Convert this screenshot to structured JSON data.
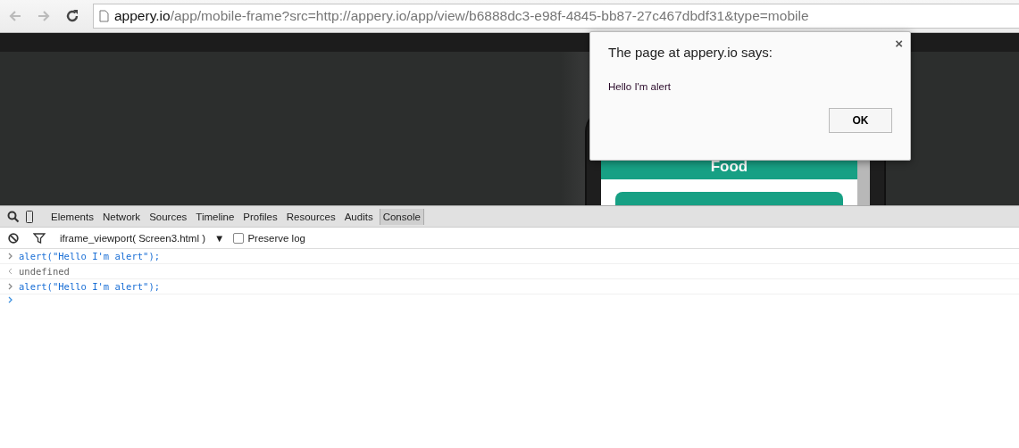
{
  "browser": {
    "url_host": "appery.io",
    "url_path": "/app/mobile-frame?src=http://appery.io/app/view/b6888dc3-e98f-4845-bb87-27c467dbdf31&type=mobile"
  },
  "app_preview": {
    "header": "Food"
  },
  "dialog": {
    "title": "The page at appery.io says:",
    "message": "Hello I'm alert",
    "ok": "OK",
    "close": "×"
  },
  "devtools": {
    "tabs": [
      {
        "label": "Elements",
        "selected": false
      },
      {
        "label": "Network",
        "selected": false
      },
      {
        "label": "Sources",
        "selected": false
      },
      {
        "label": "Timeline",
        "selected": false
      },
      {
        "label": "Profiles",
        "selected": false
      },
      {
        "label": "Resources",
        "selected": false
      },
      {
        "label": "Audits",
        "selected": false
      },
      {
        "label": "Console",
        "selected": true
      }
    ],
    "context": "iframe_viewport( Screen3.html )",
    "dropdown": "▼",
    "preserve_log": {
      "label": "Preserve log",
      "checked": false
    },
    "lines": [
      {
        "kind": "input",
        "text": "alert(\"Hello I'm alert\");"
      },
      {
        "kind": "output",
        "text": "undefined"
      },
      {
        "kind": "input",
        "text": "alert(\"Hello I'm alert\");"
      },
      {
        "kind": "prompt"
      }
    ]
  }
}
